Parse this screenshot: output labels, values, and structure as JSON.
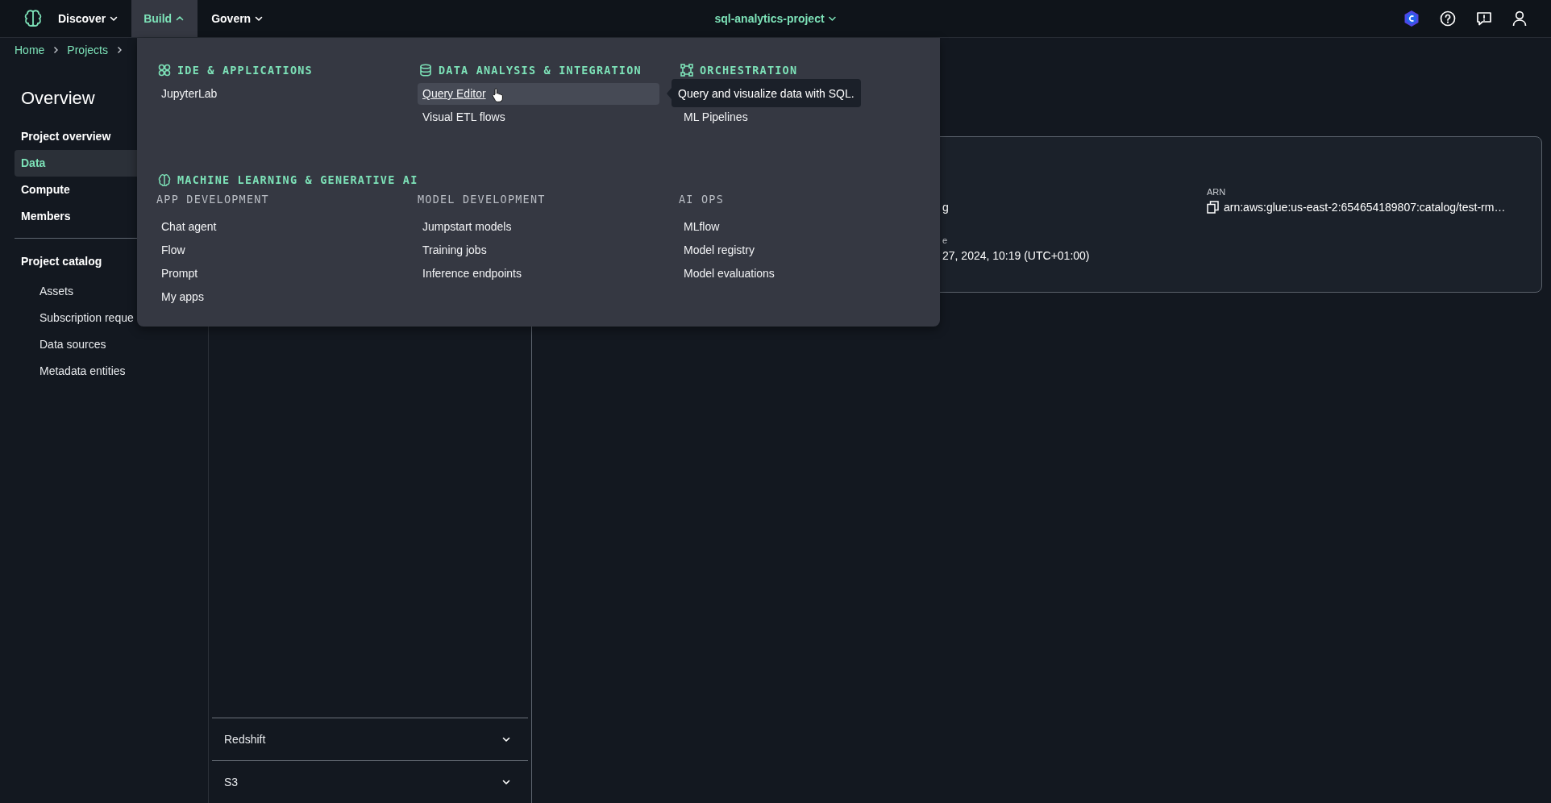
{
  "top_nav": {
    "items": [
      {
        "label": "Discover",
        "selected": false,
        "expanded": false
      },
      {
        "label": "Build",
        "selected": true,
        "expanded": true
      },
      {
        "label": "Govern",
        "selected": false,
        "expanded": false
      }
    ],
    "project": "sql-analytics-project"
  },
  "breadcrumbs": [
    "Home",
    "Projects"
  ],
  "sidebar": {
    "title": "Overview",
    "items": [
      {
        "label": "Project overview",
        "selected": false
      },
      {
        "label": "Data",
        "selected": true
      },
      {
        "label": "Compute",
        "selected": false
      },
      {
        "label": "Members",
        "selected": false
      }
    ],
    "catalog": {
      "title": "Project catalog",
      "items": [
        {
          "label": "Assets",
          "selected": false
        },
        {
          "label": "Subscription reque",
          "selected": false
        },
        {
          "label": "Data sources",
          "selected": false
        },
        {
          "label": "Metadata entities",
          "selected": false
        }
      ]
    }
  },
  "data_panel": {
    "sections": [
      {
        "label": "Redshift",
        "expanded": false
      },
      {
        "label": "S3",
        "expanded": false
      }
    ]
  },
  "details_card": {
    "fields": [
      {
        "value": "g"
      },
      {
        "label": "e",
        "value": "27, 2024, 10:19 (UTC+01:00)"
      }
    ],
    "arn": {
      "label": "ARN",
      "value": "arn:aws:glue:us-east-2:654654189807:catalog/test-rm…"
    }
  },
  "build_menu": {
    "sections": [
      {
        "title": "IDE & APPLICATIONS",
        "items": [
          {
            "label": "JupyterLab",
            "hovered": false
          }
        ]
      },
      {
        "title": "DATA ANALYSIS & INTEGRATION",
        "items": [
          {
            "label": "Query Editor",
            "hovered": true
          },
          {
            "label": "Visual ETL flows",
            "hovered": false
          }
        ]
      },
      {
        "title": "ORCHESTRATION",
        "items": [
          {
            "label": "ML Pipelines",
            "hovered": false
          }
        ]
      },
      {
        "title": "MACHINE LEARNING & GENERATIVE AI",
        "groups": [
          {
            "title": "APP DEVELOPMENT",
            "items": [
              {
                "label": "Chat agent",
                "hovered": false
              },
              {
                "label": "Flow",
                "hovered": false
              },
              {
                "label": "Prompt",
                "hovered": false
              },
              {
                "label": "My apps",
                "hovered": false
              }
            ]
          },
          {
            "title": "MODEL DEVELOPMENT",
            "items": [
              {
                "label": "Jumpstart models",
                "hovered": false
              },
              {
                "label": "Training jobs",
                "hovered": false
              },
              {
                "label": "Inference endpoints",
                "hovered": false
              }
            ]
          },
          {
            "title": "AI OPS",
            "items": [
              {
                "label": "MLflow",
                "hovered": false
              },
              {
                "label": "Model registry",
                "hovered": false
              },
              {
                "label": "Model evaluations",
                "hovered": false
              }
            ]
          }
        ]
      }
    ],
    "tooltip": "Query and visualize data with SQL."
  }
}
